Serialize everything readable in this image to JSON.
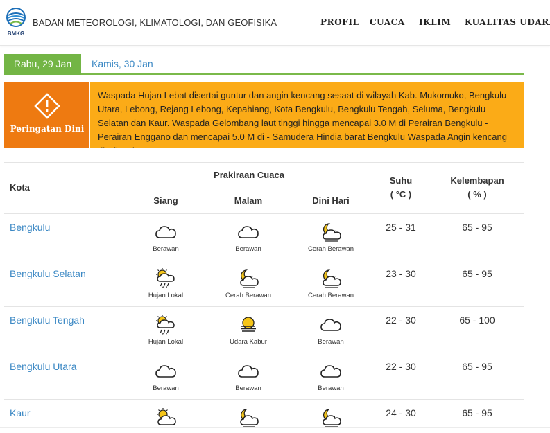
{
  "header": {
    "logo_text": "BMKG",
    "org_name": "BADAN METEOROLOGI, KLIMATOLOGI, DAN GEOFISIKA",
    "nav": [
      "PROFIL",
      "CUACA",
      "IKLIM",
      "KUALITAS UDARA"
    ]
  },
  "tabs": [
    "Rabu, 29 Jan",
    "Kamis, 30 Jan"
  ],
  "warning": {
    "label": "Peringatan Dini",
    "text": "Waspada Hujan Lebat disertai guntur dan angin kencang sesaat di wilayah Kab. Mukomuko, Bengkulu Utara, Lebong, Rejang Lebong, Kepahiang, Kota Bengkulu, Bengkulu Tengah, Seluma, Bengkulu Selatan dan Kaur.   Waspada Gelombang laut tinggi hingga mencapai 3.0 M di Perairan Bengkulu - Perairan Enggano  dan mencapai 5.0 M di - Samudera Hindia barat Bengkulu Waspada Angin kencang di wilayah"
  },
  "table": {
    "col_kota": "Kota",
    "col_prakiraan": "Prakiraan Cuaca",
    "col_siang": "Siang",
    "col_malam": "Malam",
    "col_dini": "Dini Hari",
    "col_suhu": "Suhu",
    "col_suhu_unit": "( °C )",
    "col_kelembapan": "Kelembapan",
    "col_kelembapan_unit": "( % )",
    "rows": [
      {
        "city": "Bengkulu",
        "siang": "Berawan",
        "malam": "Berawan",
        "dini": "Cerah Berawan",
        "suhu": "25 - 31",
        "kelembapan": "65 - 95",
        "icons": [
          "cloud-icon",
          "cloud-icon",
          "moon-cloud-icon"
        ]
      },
      {
        "city": "Bengkulu Selatan",
        "siang": "Hujan Lokal",
        "malam": "Cerah Berawan",
        "dini": "Cerah Berawan",
        "suhu": "23 - 30",
        "kelembapan": "65 - 95",
        "icons": [
          "sun-rain-icon",
          "moon-cloud-icon",
          "moon-cloud-icon"
        ]
      },
      {
        "city": "Bengkulu Tengah",
        "siang": "Hujan Lokal",
        "malam": "Udara Kabur",
        "dini": "Berawan",
        "suhu": "22 - 30",
        "kelembapan": "65 - 100",
        "icons": [
          "sun-rain-icon",
          "haze-icon",
          "cloud-icon"
        ]
      },
      {
        "city": "Bengkulu Utara",
        "siang": "Berawan",
        "malam": "Berawan",
        "dini": "Berawan",
        "suhu": "22 - 30",
        "kelembapan": "65 - 95",
        "icons": [
          "cloud-icon",
          "cloud-icon",
          "cloud-icon"
        ]
      },
      {
        "city": "Kaur",
        "siang": "",
        "malam": "",
        "dini": "",
        "suhu": "24 - 30",
        "kelembapan": "65 - 95",
        "icons": [
          "sun-cloud-icon",
          "moon-cloud-icon",
          "moon-cloud-icon"
        ]
      }
    ]
  },
  "colors": {
    "tab_active": "#73b545",
    "warning_dark": "#ee7a11",
    "warning_light": "#fbab17",
    "link": "#3b88c4"
  }
}
